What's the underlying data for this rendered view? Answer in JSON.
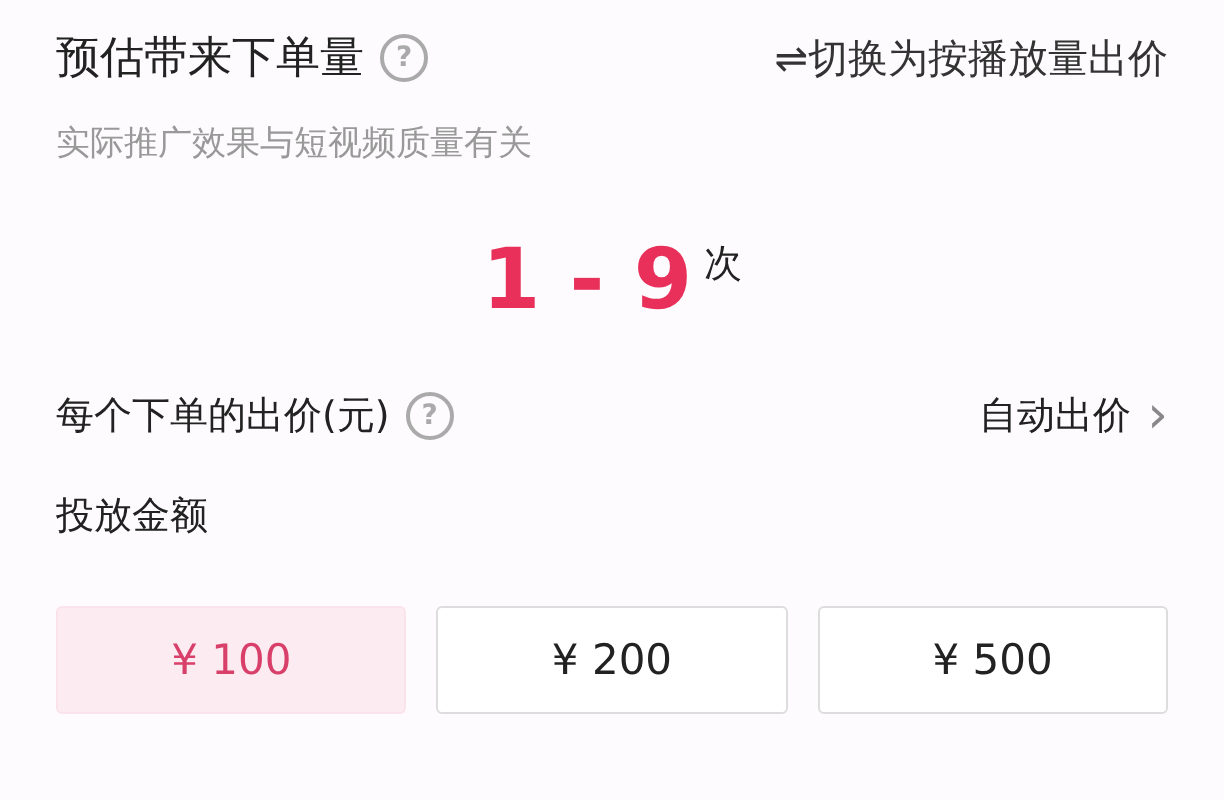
{
  "header": {
    "title": "预估带来下单量",
    "help": "?",
    "switch_link": "⇌切换为按播放量出价"
  },
  "subtitle": "实际推广效果与短视频质量有关",
  "estimate": {
    "range": "1 - 9",
    "unit": "次"
  },
  "bid_row": {
    "label": "每个下单的出价(元)",
    "help": "?",
    "value": "自动出价",
    "chevron": "›"
  },
  "budget": {
    "label": "投放金额",
    "options": [
      {
        "label": "¥ 100",
        "selected": true
      },
      {
        "label": "¥ 200",
        "selected": false
      },
      {
        "label": "¥ 500",
        "selected": false
      }
    ]
  }
}
